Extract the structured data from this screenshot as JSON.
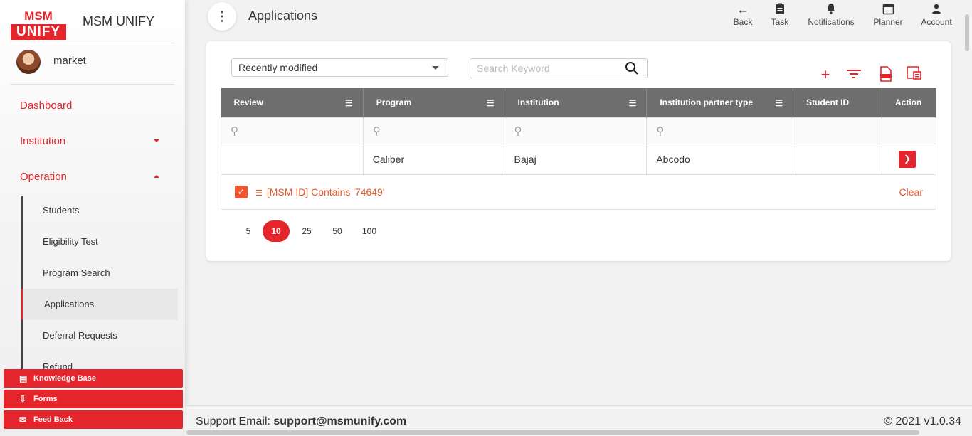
{
  "brand": {
    "logo_top": "MSM",
    "logo_bottom": "UNIFY",
    "name": "MSM UNIFY"
  },
  "user": {
    "name": "market"
  },
  "nav": {
    "dashboard": "Dashboard",
    "institution": "Institution",
    "operation": "Operation",
    "sub_items": [
      "Students",
      "Eligibility Test",
      "Program Search",
      "Applications",
      "Deferral Requests",
      "Refund"
    ]
  },
  "bottom_buttons": {
    "knowledge_base": "Knowledge Base",
    "forms": "Forms",
    "feedback": "Feed Back"
  },
  "header": {
    "title": "Applications",
    "actions": {
      "back": "Back",
      "task": "Task",
      "notifications": "Notifications",
      "planner": "Planner",
      "account": "Account"
    }
  },
  "toolbar": {
    "sort_selected": "Recently modified",
    "search_placeholder": "Search Keyword"
  },
  "table": {
    "columns": [
      "Review",
      "Program",
      "Institution",
      "Institution partner type",
      "Student ID",
      "Action"
    ],
    "rows": [
      {
        "review": "",
        "program": "Caliber",
        "institution": "Bajaj",
        "partner_type": "Abcodo",
        "student_id": ""
      }
    ]
  },
  "filter": {
    "text": "[MSM ID] Contains '74649'",
    "clear": "Clear"
  },
  "pager": {
    "sizes": [
      "5",
      "10",
      "25",
      "50",
      "100"
    ],
    "active": "10"
  },
  "footer": {
    "support_label": "Support Email:",
    "support_email": "support@msmunify.com",
    "version": "© 2021 v1.0.34"
  },
  "colors": {
    "accent": "#e4252b",
    "header_bg": "#6e6e6e"
  }
}
